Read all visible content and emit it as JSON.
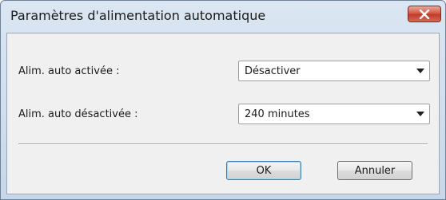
{
  "window": {
    "title": "Paramètres d'alimentation automatique",
    "close_icon": "close-icon"
  },
  "form": {
    "auto_power_on": {
      "label": "Alim. auto activée :",
      "value": "Désactiver"
    },
    "auto_power_off": {
      "label": "Alim. auto désactivée :",
      "value": "240 minutes"
    }
  },
  "buttons": {
    "ok_label": "OK",
    "cancel_label": "Annuler"
  },
  "colors": {
    "titlebar": "#c7d7ea",
    "close_button": "#c0392b",
    "client_background": "#f0f0f0",
    "default_button_border": "#3c7fb1"
  }
}
